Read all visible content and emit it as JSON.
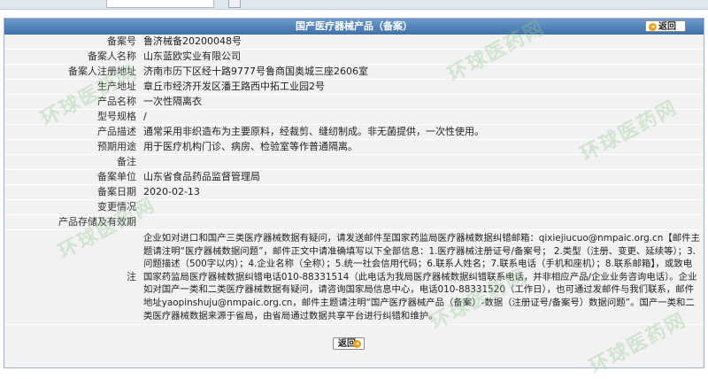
{
  "page": {
    "title": "国产医疗器械产品（备案）",
    "back_label": "返回",
    "watermark": "环球医药网"
  },
  "icons": {
    "back": "arrow-left-icon",
    "arrow_glyph": "◂"
  },
  "colors": {
    "titlebar": "#4a7bb5",
    "panel_bg": "#f2f2f2",
    "back_arrow": "#e8a020"
  },
  "record": {
    "rows": [
      {
        "label": "备案号",
        "value": "鲁济械备20200048号"
      },
      {
        "label": "备案人名称",
        "value": "山东蓝欧实业有限公司"
      },
      {
        "label": "备案人注册地址",
        "value": "济南市历下区经十路9777号鲁商国奥城三座2606室"
      },
      {
        "label": "生产地址",
        "value": "章丘市经济开发区潘王路西中拓工业园2号"
      },
      {
        "label": "产品名称",
        "value": "一次性隔离衣"
      },
      {
        "label": "型号规格",
        "value": "/"
      },
      {
        "label": "产品描述",
        "value": "通常采用非织造布为主要原料，经裁剪、缝纫制成。非无菌提供，一次性使用。"
      },
      {
        "label": "预期用途",
        "value": "用于医疗机构门诊、病房、检验室等作普通隔离。"
      },
      {
        "label": "备注",
        "value": ""
      },
      {
        "label": "备案单位",
        "value": "山东省食品药品监督管理局"
      },
      {
        "label": "备案日期",
        "value": "2020-02-13"
      },
      {
        "label": "变更情况",
        "value": ""
      },
      {
        "label": "产品存储及有效期",
        "value": ""
      }
    ],
    "remark_label": "注",
    "remark_text": "企业如对进口和国产三类医疗器械数据有疑问，请发送邮件至国家药监局医疗器械数据纠错邮箱：qixiejiucuo@nmpaic.org.cn【邮件主题请注明“医疗器械数据问题”，邮件正文中请准确填写以下全部信息：1.医疗器械注册证号/备案号； 2.类型（注册、变更、延续等）；3.问题描述（500字以内）；4.企业名称（全称）；5.统一社会信用代码；6.联系人姓名；7.联系电话（手机和座机）；8.联系邮箱】，或致电国家药监局医疗器械数据纠错电话010-88331514（此电话为我局医疗器械数据纠错联系电话，并非相应产品/企业业务咨询电话）。企业如对国产一类和二类医疗器械数据有疑问，请咨询国家局信息中心，电话010-88331520（工作日），也可通过发邮件与我们联系，邮件地址yaopinshuju@nmpaic.org.cn，邮件主题请注明“国产医疗器械产品（备案）-数据（注册证号/备案号）数据问题”。国产一类和二类医疗器械数据来源于省局，由省局通过数据共享平台进行纠错和维护。"
  }
}
